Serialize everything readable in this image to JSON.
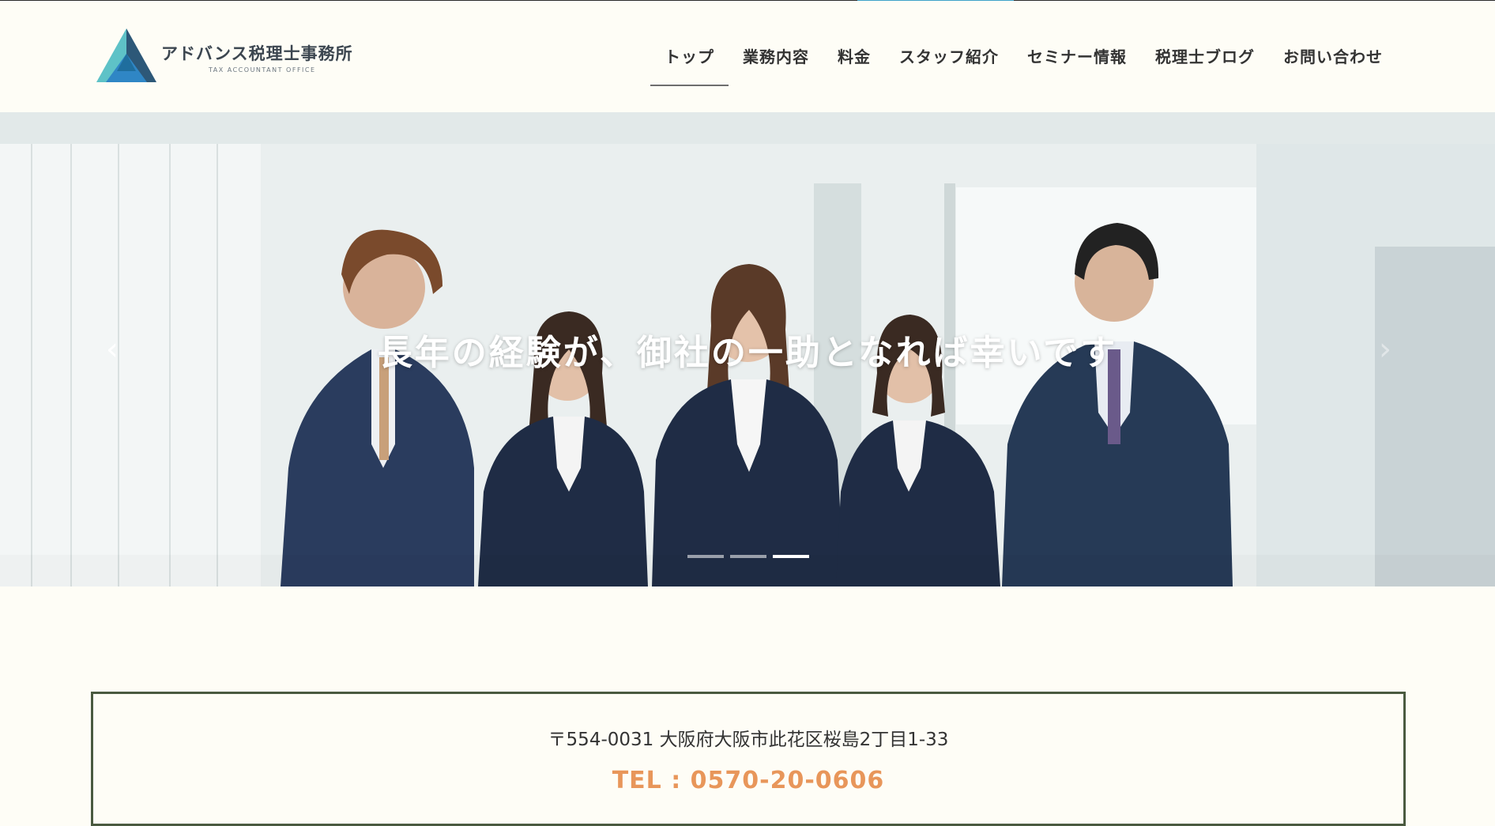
{
  "header": {
    "logo_title": "アドバンス税理士事務所",
    "logo_subtitle": "TAX ACCOUNTANT OFFICE"
  },
  "nav": {
    "items": [
      {
        "label": "トップ",
        "active": true
      },
      {
        "label": "業務内容"
      },
      {
        "label": "料金"
      },
      {
        "label": "スタッフ紹介"
      },
      {
        "label": "セミナー情報"
      },
      {
        "label": "税理士ブログ"
      },
      {
        "label": "お問い合わせ"
      }
    ]
  },
  "hero": {
    "caption": "長年の経験が、御社の一助となれば幸いです",
    "prev_icon": "‹",
    "next_icon": "›",
    "slide_count": 3,
    "active_slide": 3
  },
  "contact": {
    "address": "〒554-0031 大阪府大阪市此花区桜島2丁目1-33",
    "tel": "TEL : 0570-20-0606"
  },
  "colors": {
    "background": "#fefdf6",
    "accent_top": "#3fa3c9",
    "tel": "#e8965a",
    "border": "#4a5a40"
  }
}
